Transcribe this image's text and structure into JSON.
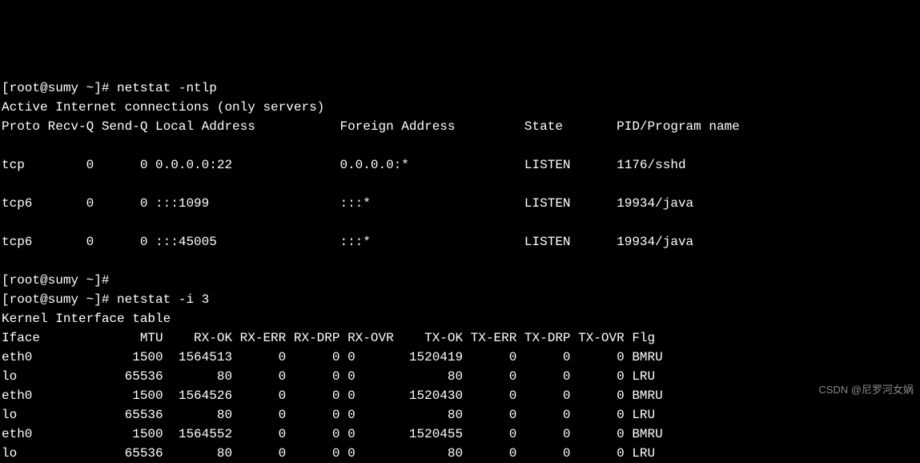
{
  "prompt1": "[root@sumy ~]# ",
  "cmd1": "netstat -ntlp",
  "header1": "Active Internet connections (only servers)",
  "cols1": "Proto Recv-Q Send-Q Local Address           Foreign Address         State       PID/Program name",
  "netstat_rows": [
    "tcp        0      0 0.0.0.0:22              0.0.0.0:*               LISTEN      1176/sshd",
    "tcp6       0      0 :::1099                 :::*                    LISTEN      19934/java",
    "tcp6       0      0 :::45005                :::*                    LISTEN      19934/java"
  ],
  "prompt2": "[root@sumy ~]# ",
  "prompt3": "[root@sumy ~]# ",
  "cmd2": "netstat -i 3",
  "header2": "Kernel Interface table",
  "cols2": "Iface             MTU    RX-OK RX-ERR RX-DRP RX-OVR    TX-OK TX-ERR TX-DRP TX-OVR Flg",
  "iface_rows": [
    "eth0             1500  1564513      0      0 0       1520419      0      0      0 BMRU",
    "lo              65536       80      0      0 0            80      0      0      0 LRU",
    "eth0             1500  1564526      0      0 0       1520430      0      0      0 BMRU",
    "lo              65536       80      0      0 0            80      0      0      0 LRU",
    "eth0             1500  1564552      0      0 0       1520455      0      0      0 BMRU",
    "lo              65536       80      0      0 0            80      0      0      0 LRU"
  ],
  "watermark": "CSDN @尼罗河女娲"
}
